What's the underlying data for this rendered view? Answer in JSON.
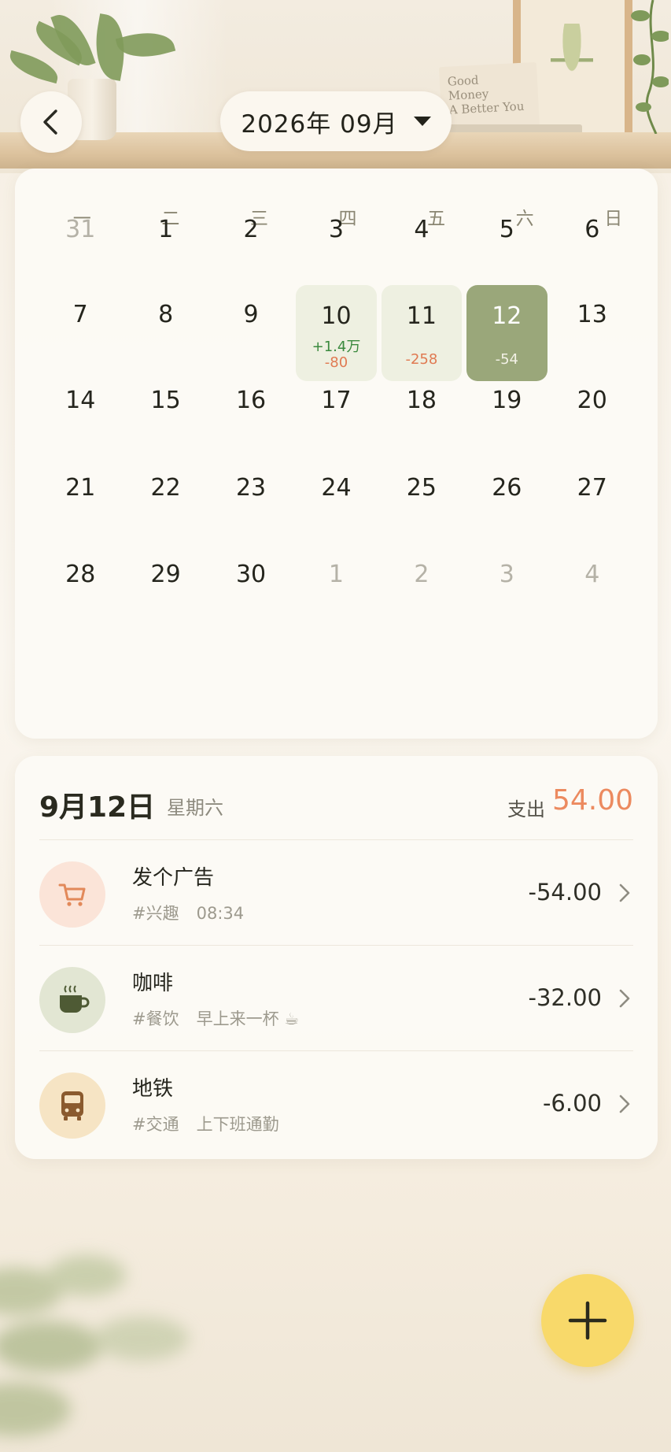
{
  "header": {
    "month_label": "2026年 09月"
  },
  "decor": {
    "stand_card_lines": [
      "Good",
      "Money",
      "A Better You"
    ]
  },
  "calendar": {
    "weekdays": [
      "一",
      "二",
      "三",
      "四",
      "五",
      "六",
      "日"
    ],
    "weeks": [
      [
        {
          "d": "31",
          "dim": true
        },
        {
          "d": "1"
        },
        {
          "d": "2"
        },
        {
          "d": "3"
        },
        {
          "d": "4"
        },
        {
          "d": "5"
        },
        {
          "d": "6"
        }
      ],
      [
        {
          "d": "7"
        },
        {
          "d": "8"
        },
        {
          "d": "9"
        },
        {
          "d": "10",
          "income": "+1.4万",
          "expense": "-80"
        },
        {
          "d": "11",
          "expense": "-258"
        },
        {
          "d": "12",
          "expense": "-54",
          "selected": true
        },
        {
          "d": "13"
        }
      ],
      [
        {
          "d": "14"
        },
        {
          "d": "15"
        },
        {
          "d": "16"
        },
        {
          "d": "17"
        },
        {
          "d": "18"
        },
        {
          "d": "19"
        },
        {
          "d": "20"
        }
      ],
      [
        {
          "d": "21"
        },
        {
          "d": "22"
        },
        {
          "d": "23"
        },
        {
          "d": "24"
        },
        {
          "d": "25"
        },
        {
          "d": "26"
        },
        {
          "d": "27"
        }
      ],
      [
        {
          "d": "28"
        },
        {
          "d": "29"
        },
        {
          "d": "30"
        },
        {
          "d": "1",
          "dim": true
        },
        {
          "d": "2",
          "dim": true
        },
        {
          "d": "3",
          "dim": true
        },
        {
          "d": "4",
          "dim": true
        }
      ]
    ]
  },
  "details": {
    "date": "9月12日",
    "weekday": "星期六",
    "total_label": "支出",
    "total_value": "54.00",
    "transactions": [
      {
        "title": "发个广告",
        "tag": "#兴趣",
        "note": "08:34",
        "amount": "-54.00",
        "icon": "shopping-cart-icon"
      },
      {
        "title": "咖啡",
        "tag": "#餐饮",
        "note": "早上来一杯 ☕",
        "amount": "-32.00",
        "icon": "coffee-cup-icon"
      },
      {
        "title": "地铁",
        "tag": "#交通",
        "note": "上下班通勤",
        "amount": "-6.00",
        "icon": "bus-icon"
      }
    ]
  },
  "colors": {
    "accent_green": "#9aa77a",
    "expense_orange": "#ec8a5f",
    "income_green": "#3b8a3e",
    "fab_yellow": "#f8d96a"
  }
}
